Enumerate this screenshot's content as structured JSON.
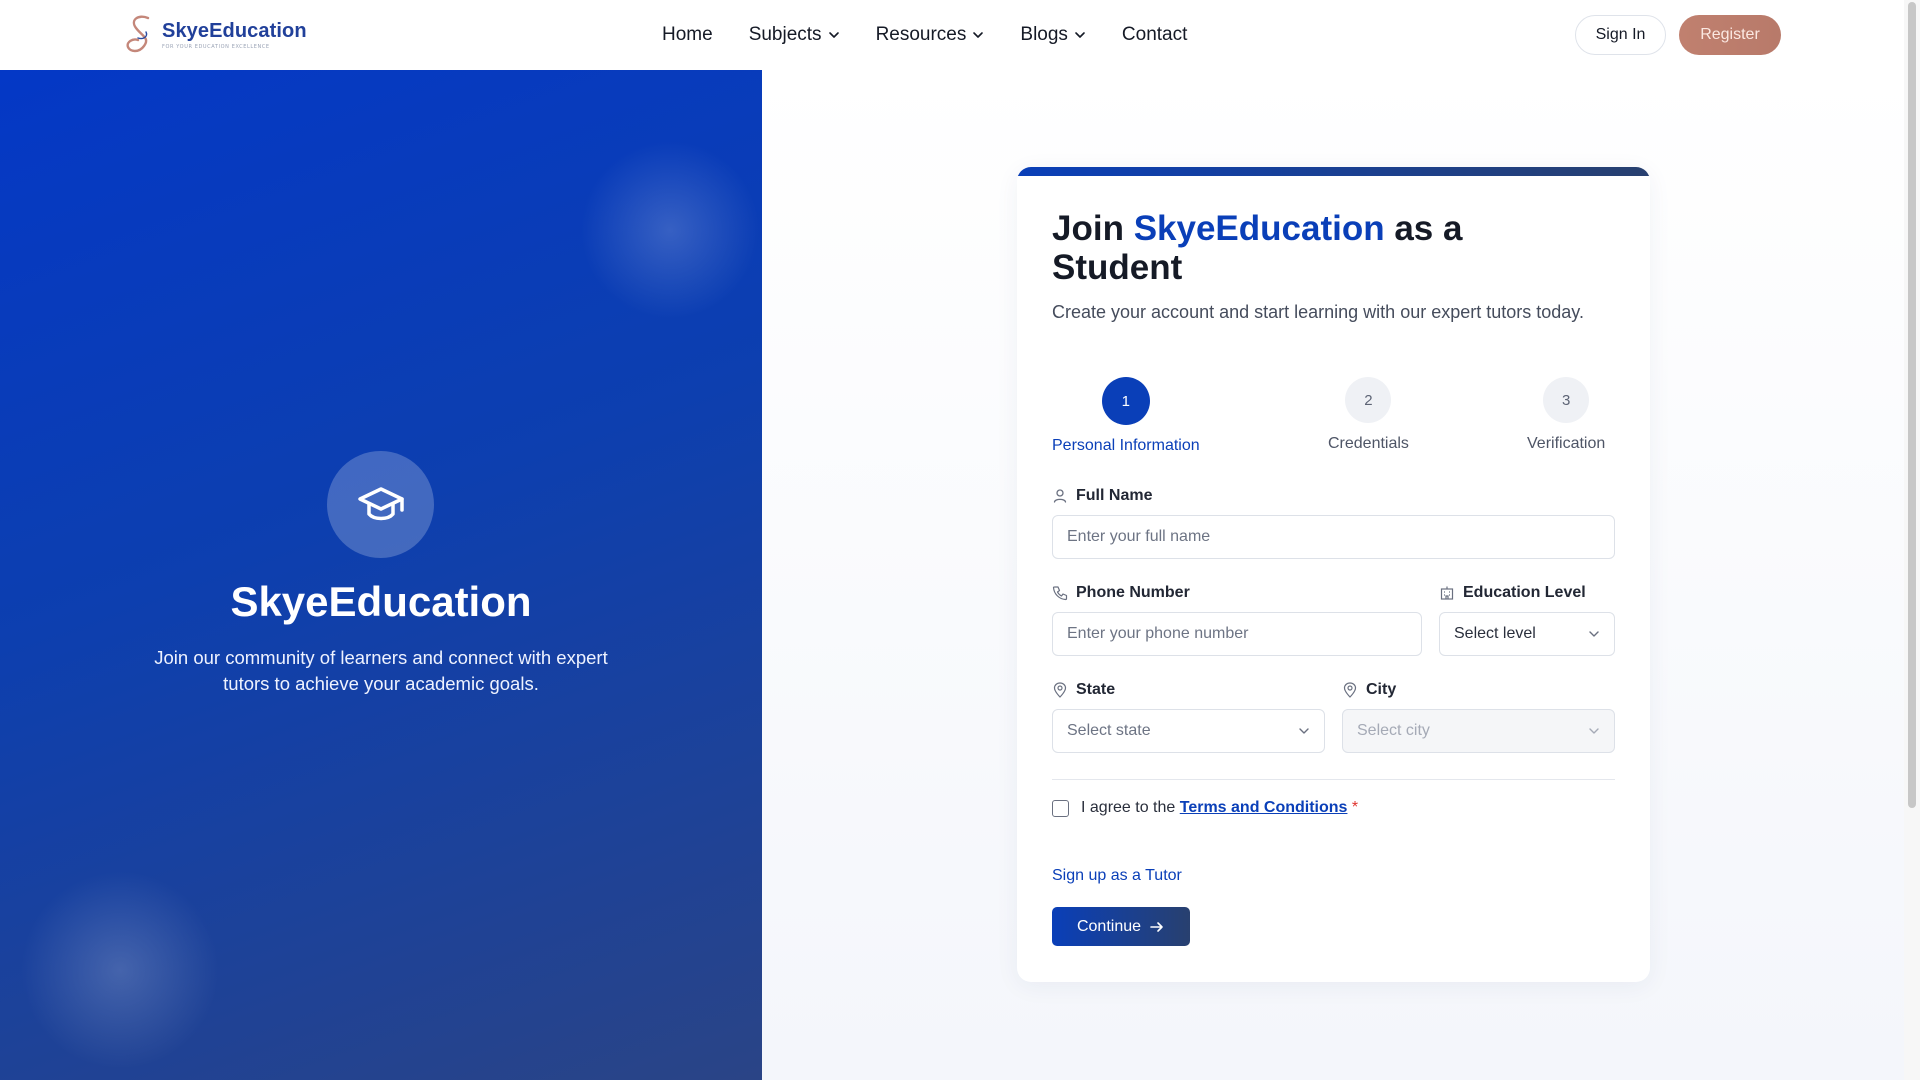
{
  "header": {
    "logo_name": "SkyeEducation",
    "logo_tagline": "FOR YOUR EDUCATION EXCELLENCE",
    "nav": [
      {
        "label": "Home",
        "dropdown": false
      },
      {
        "label": "Subjects",
        "dropdown": true
      },
      {
        "label": "Resources",
        "dropdown": true
      },
      {
        "label": "Blogs",
        "dropdown": true
      },
      {
        "label": "Contact",
        "dropdown": false
      }
    ],
    "sign_in": "Sign In",
    "register": "Register"
  },
  "hero": {
    "icon": "graduation-cap-icon",
    "title": "SkyeEducation",
    "subtitle": "Join our community of learners and connect with expert tutors to achieve your academic goals."
  },
  "form": {
    "title_prefix": "Join ",
    "title_brand": "SkyeEducation",
    "title_suffix": " as a Student",
    "subtitle": "Create your account and start learning with our expert tutors today.",
    "steps": [
      {
        "number": "1",
        "label": "Personal Information",
        "active": true
      },
      {
        "number": "2",
        "label": "Credentials",
        "active": false
      },
      {
        "number": "3",
        "label": "Verification",
        "active": false
      }
    ],
    "full_name": {
      "label": "Full Name",
      "placeholder": "Enter your full name",
      "icon": "user-icon"
    },
    "phone": {
      "label": "Phone Number",
      "placeholder": "Enter your phone number",
      "icon": "phone-icon"
    },
    "education": {
      "label": "Education Level",
      "value": "Select level",
      "icon": "building-icon"
    },
    "state": {
      "label": "State",
      "value": "Select state",
      "icon": "map-pin-icon"
    },
    "city": {
      "label": "City",
      "value": "Select city",
      "icon": "map-pin-icon",
      "disabled": true
    },
    "agree_prefix": "I agree to the ",
    "terms_link": "Terms and Conditions",
    "required_mark": "*",
    "tutor_link": "Sign up as a Tutor",
    "continue": "Continue"
  },
  "colors": {
    "brand_blue": "#0a3fb8",
    "register_rose": "#c0806f",
    "required_red": "#e0342f"
  }
}
